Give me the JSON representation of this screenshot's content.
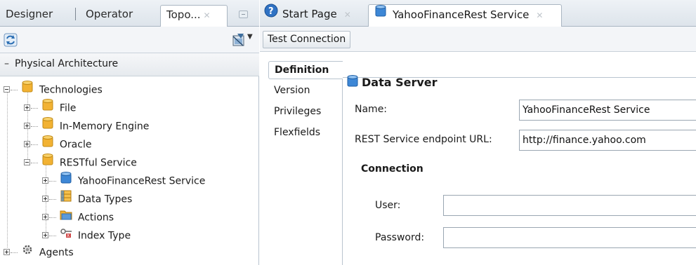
{
  "left_panel": {
    "tabs": [
      {
        "label": "Designer"
      },
      {
        "label": "Operator"
      },
      {
        "label": "Topo..."
      }
    ],
    "toolbar": {
      "icons": [
        "refresh-icon",
        "connect-menu-icon"
      ]
    },
    "section": {
      "label": "Physical Architecture"
    },
    "tree": [
      {
        "label": "Technologies",
        "icon": "folder-icon",
        "state": "expanded"
      },
      {
        "label": "File",
        "icon": "folder-icon",
        "state": "collapsed"
      },
      {
        "label": "In-Memory Engine",
        "icon": "folder-icon",
        "state": "collapsed"
      },
      {
        "label": "Oracle",
        "icon": "folder-icon",
        "state": "collapsed"
      },
      {
        "label": "RESTful Service",
        "icon": "folder-icon",
        "state": "expanded"
      },
      {
        "label": "YahooFinanceRest Service",
        "icon": "data-server-icon",
        "state": "collapsed"
      },
      {
        "label": "Data Types",
        "icon": "data-types-icon",
        "state": "collapsed"
      },
      {
        "label": "Actions",
        "icon": "actions-icon",
        "state": "collapsed"
      },
      {
        "label": "Index Type",
        "icon": "index-type-icon",
        "state": "collapsed"
      },
      {
        "label": "Agents",
        "icon": "agents-icon",
        "state": "collapsed"
      }
    ]
  },
  "right_panel": {
    "tabs": [
      {
        "label": "Start Page",
        "icon": "help-icon"
      },
      {
        "label": "YahooFinanceRest Service",
        "icon": "data-server-icon",
        "active": true
      }
    ],
    "toolbar": {
      "test_connection_label": "Test Connection"
    },
    "side_tabs": [
      {
        "label": "Definition",
        "active": true
      },
      {
        "label": "Version"
      },
      {
        "label": "Privileges"
      },
      {
        "label": "Flexfields"
      }
    ],
    "form": {
      "header": "Data Server",
      "name_label": "Name:",
      "name_value": "YahooFinanceRest Service",
      "url_label": "REST Service endpoint URL:",
      "url_value": "http://finance.yahoo.com",
      "connection_header": "Connection",
      "user_label": "User:",
      "user_value": "",
      "password_label": "Password:",
      "password_value": ""
    }
  },
  "colors": {
    "folder": "#f2b233",
    "data_server": "#3d87d6",
    "tab_bar": "#dde4eb",
    "border": "#aab6c2"
  }
}
